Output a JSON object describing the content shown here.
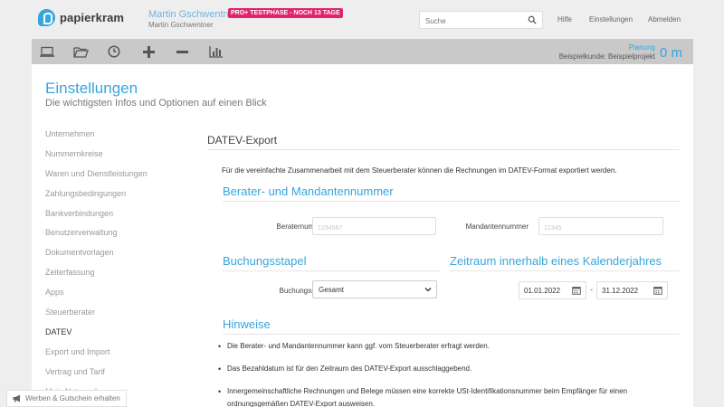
{
  "brand": {
    "name": "papierkram"
  },
  "user": {
    "name": "Martin Gschwentner",
    "badge": "PRO+ TESTPHASE - NOCH 13 TAGE",
    "sub": "Martin Gschwentner"
  },
  "search": {
    "placeholder": "Suche",
    "value": ""
  },
  "nav": {
    "hilfe": "Hilfe",
    "einstellungen": "Einstellungen",
    "abmelden": "Abmelden"
  },
  "toolbar": {
    "icons": [
      "laptop-icon",
      "folder-open-icon",
      "clock-icon",
      "plus-icon",
      "minus-icon",
      "bar-chart-icon"
    ],
    "planung": "Planung",
    "projekt": "Beispielkunde: Beispielprojekt",
    "timer": "0 m"
  },
  "page": {
    "title": "Einstellungen",
    "subtitle": "Die wichtigsten Infos und Optionen auf einen Blick"
  },
  "sidebar": {
    "items": [
      {
        "label": "Unternehmen",
        "active": false
      },
      {
        "label": "Nummernkreise",
        "active": false
      },
      {
        "label": "Waren und Dienstleistungen",
        "active": false
      },
      {
        "label": "Zahlungsbedingungen",
        "active": false
      },
      {
        "label": "Bankverbindungen",
        "active": false
      },
      {
        "label": "Benutzerverwaltung",
        "active": false
      },
      {
        "label": "Dokumentvorlagen",
        "active": false
      },
      {
        "label": "Zeiterfassung",
        "active": false
      },
      {
        "label": "Apps",
        "active": false
      },
      {
        "label": "Steuerberater",
        "active": false
      },
      {
        "label": "DATEV",
        "active": true
      },
      {
        "label": "Export und Import",
        "active": false
      },
      {
        "label": "Vertrag und Tarif",
        "active": false
      },
      {
        "label": "Mein Netzwerk",
        "active": false
      }
    ]
  },
  "datev": {
    "title": "DATEV-Export",
    "intro": "Für die vereinfachte Zusammenarbeit mit dem Steuerberater können die Rechnungen im DATEV-Format exportiert werden.",
    "berater_heading": "Berater- und Mandantennummer",
    "beraternummer_label": "Beraternummer",
    "beraternummer_placeholder": "1234567",
    "mandantennummer_label": "Mandantennummer",
    "mandantennummer_placeholder": "12345",
    "buchungsstapel_heading": "Buchungsstapel",
    "buchungsseite_label": "Buchungsseite",
    "buchungsseite_value": "Gesamt",
    "zeitraum_heading": "Zeitraum innerhalb eines Kalenderjahres",
    "date_from": "01.01.2022",
    "date_sep": "-",
    "date_to": "31.12.2022",
    "hinweise_heading": "Hinweise",
    "hinweise": [
      "Die Berater- und Mandantennummer kann ggf. vom Steuerberater erfragt werden.",
      "Das Bezahldatum ist für den Zeitraum des DATEV-Export ausschlaggebend.",
      "Innergemeinschaftliche Rechnungen und Belege müssen eine korrekte USt-Identifikationsnummer beim Empfänger für einen ordnungsgemäßen DATEV-Export ausweisen."
    ]
  },
  "referral": {
    "label": "Werben & Gutschein erhalten"
  },
  "colors": {
    "accent": "#37a5de",
    "badge": "#e0246f",
    "toolbar": "#c9c9c9"
  }
}
